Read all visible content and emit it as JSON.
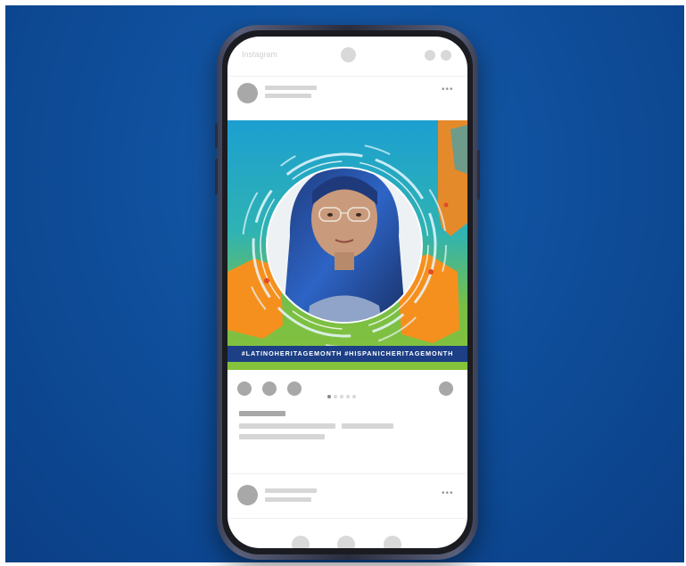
{
  "background_color": "#0f4f9c",
  "app": {
    "title": "Instagram"
  },
  "post": {
    "hashtags": "#LATINOHERITAGEMONTH #HISPANICHERITAGEMONTH",
    "more_icon": "more-horizontal-icon",
    "carousel": {
      "count": 5,
      "active_index": 0
    }
  },
  "actions": [
    "like-icon",
    "comment-icon",
    "share-icon",
    "save-icon"
  ],
  "bottom_nav": [
    "home-icon",
    "search-icon",
    "profile-icon"
  ],
  "colors": {
    "hashtag_bar": "#1c3f86",
    "image_teal": "#1fa7c9",
    "image_orange": "#f5901e",
    "image_green": "#7fbf3a"
  }
}
